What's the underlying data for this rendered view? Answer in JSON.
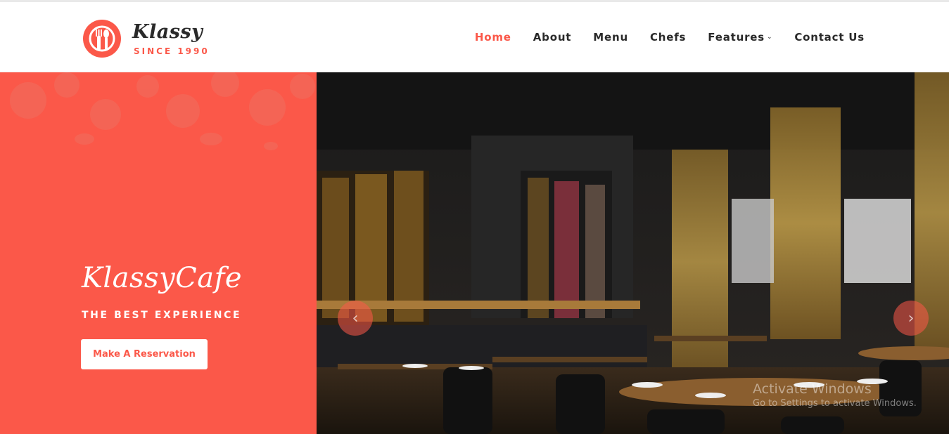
{
  "brand": {
    "name": "Klassy",
    "since": "SINCE 1990",
    "logo_icon": "fork-spoon-plate-icon",
    "accent_color": "#fb5849"
  },
  "nav": {
    "items": [
      {
        "label": "Home",
        "active": true
      },
      {
        "label": "About",
        "active": false
      },
      {
        "label": "Menu",
        "active": false
      },
      {
        "label": "Chefs",
        "active": false
      },
      {
        "label": "Features",
        "active": false,
        "has_dropdown": true
      },
      {
        "label": "Contact Us",
        "active": false
      }
    ],
    "dropdown_icon": "chevron-down-icon"
  },
  "hero": {
    "title": "KlassyCafe",
    "subtitle": "THE BEST EXPERIENCE",
    "cta_label": "Make A Reservation",
    "slider_prev_icon": "chevron-left-icon",
    "slider_next_icon": "chevron-right-icon",
    "prev_glyph": "‹",
    "next_glyph": "›",
    "image_subject": "restaurant-interior-photo"
  },
  "os_watermark": {
    "title": "Activate Windows",
    "subtitle": "Go to Settings to activate Windows."
  }
}
